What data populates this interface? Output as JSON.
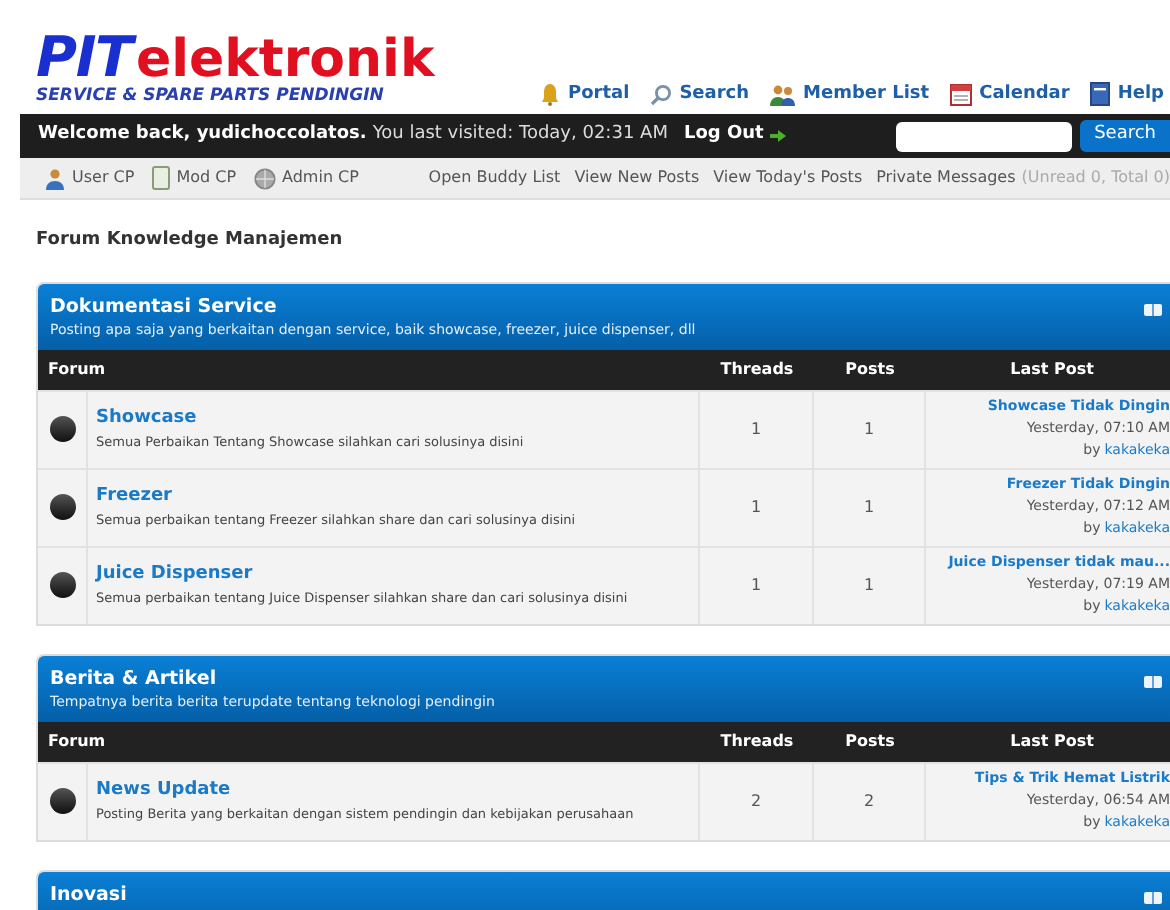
{
  "logo": {
    "brand_a": "PIT",
    "brand_b": "elektronik",
    "tagline": "SERVICE & SPARE PARTS PENDINGIN"
  },
  "top_nav": [
    {
      "label": "Portal",
      "kind": "bell"
    },
    {
      "label": "Search",
      "kind": "search"
    },
    {
      "label": "Member List",
      "kind": "members"
    },
    {
      "label": "Calendar",
      "kind": "calendar"
    },
    {
      "label": "Help",
      "kind": "help"
    }
  ],
  "welcome_bar": {
    "greeting": "Welcome back, yudichoccolatos.",
    "last_visited": "You last visited: Today, 02:31 AM",
    "logout": "Log Out",
    "search_button": "Search"
  },
  "sub_nav": {
    "left": [
      {
        "label": "User CP",
        "kind": "user"
      },
      {
        "label": "Mod CP",
        "kind": "mod"
      },
      {
        "label": "Admin CP",
        "kind": "admin"
      }
    ],
    "right": [
      "Open Buddy List",
      "View New Posts",
      "View Today's Posts"
    ],
    "messages": "Private Messages",
    "messages_count": "(Unread 0, Total 0)"
  },
  "board_title": "Forum Knowledge Manajemen",
  "categories": [
    {
      "title": "Dokumentasi Service",
      "description": "Posting apa saja yang berkaitan dengan service, baik showcase, freezer, juice dispenser, dll",
      "columns": [
        "Forum",
        "Threads",
        "Posts",
        "Last Post"
      ],
      "forums": [
        {
          "name": "Showcase",
          "description": "Semua Perbaikan Tentang Showcase silahkan cari solusinya disini",
          "threads": "1",
          "posts": "1",
          "last_title": "Showcase Tidak Dingin",
          "last_time": "Yesterday, 07:10 AM",
          "last_by": "by",
          "last_user": "kakakeka"
        },
        {
          "name": "Freezer",
          "description": "Semua perbaikan tentang Freezer silahkan share dan cari solusinya disini",
          "threads": "1",
          "posts": "1",
          "last_title": "Freezer Tidak Dingin",
          "last_time": "Yesterday, 07:12 AM",
          "last_by": "by",
          "last_user": "kakakeka"
        },
        {
          "name": "Juice Dispenser",
          "description": "Semua perbaikan tentang Juice Dispenser silahkan share dan cari solusinya disini",
          "threads": "1",
          "posts": "1",
          "last_title": "Juice Dispenser tidak mau...",
          "last_time": "Yesterday, 07:19 AM",
          "last_by": "by",
          "last_user": "kakakeka"
        }
      ]
    },
    {
      "title": "Berita & Artikel",
      "description": "Tempatnya berita berita terupdate tentang teknologi pendingin",
      "columns": [
        "Forum",
        "Threads",
        "Posts",
        "Last Post"
      ],
      "forums": [
        {
          "name": "News Update",
          "description": "Posting Berita yang berkaitan dengan sistem pendingin dan kebijakan perusahaan",
          "threads": "2",
          "posts": "2",
          "last_title": "Tips & Trik Hemat Listrik",
          "last_time": "Yesterday, 06:54 AM",
          "last_by": "by",
          "last_user": "kakakeka"
        }
      ]
    },
    {
      "title": "Inovasi"
    }
  ]
}
